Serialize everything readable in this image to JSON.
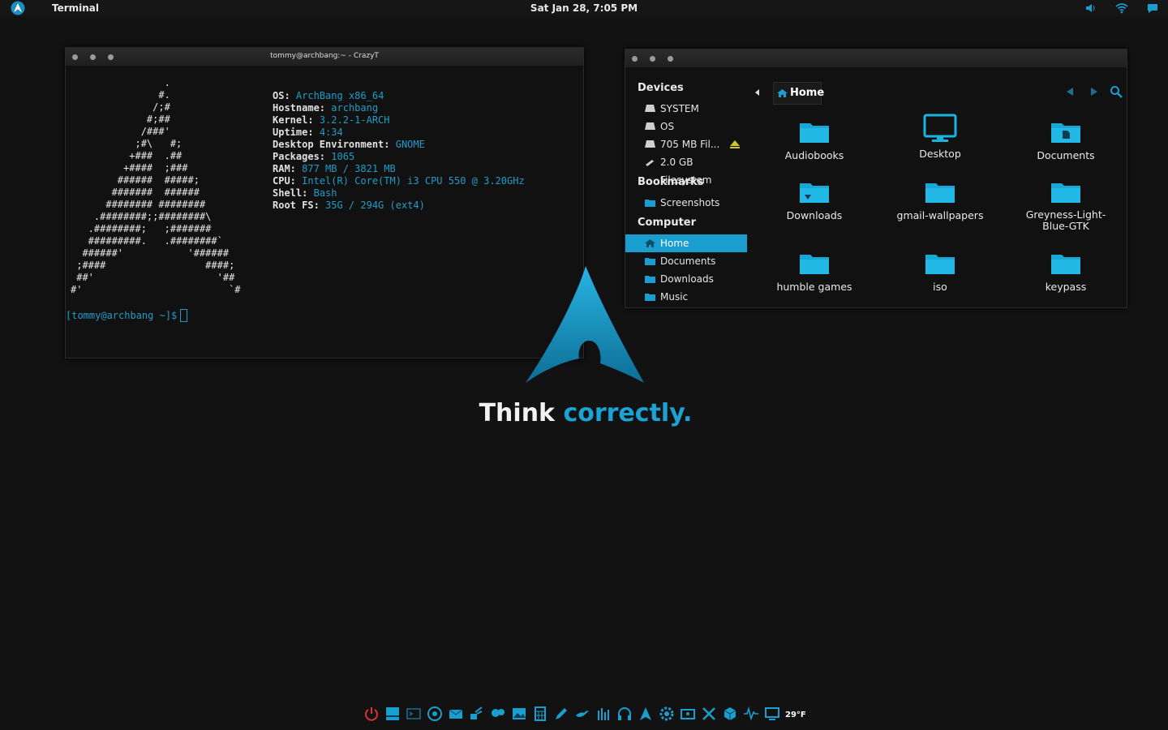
{
  "topbar": {
    "app_name": "Terminal",
    "clock": "Sat Jan 28, 7:05 PM"
  },
  "terminal": {
    "title": "tommy@archbang:~ - CrazyT",
    "ascii_art": "                .\n               #.\n              /;#\n             #;##\n            /###'\n           ;#\\   #;\n          +###  .##\n         +####  ;###\n        ######  #####;\n       #######  ######\n      ######## ########\n    .########;;########\\\n   .########;   ;#######\n   #########.   .########`\n  ######'           '######\n ;####                 ####;\n ##'                     '##\n#'                         `#",
    "info": [
      {
        "key": "OS:",
        "value": "ArchBang x86_64"
      },
      {
        "key": "Hostname:",
        "value": "archbang"
      },
      {
        "key": "Kernel:",
        "value": "3.2.2-1-ARCH"
      },
      {
        "key": "Uptime:",
        "value": "4:34"
      },
      {
        "key": "Desktop Environment:",
        "value": "GNOME"
      },
      {
        "key": "Packages:",
        "value": "1065"
      },
      {
        "key": "RAM:",
        "value": "877 MB / 3821 MB"
      },
      {
        "key": "CPU:",
        "value": "Intel(R) Core(TM) i3 CPU 550 @ 3.20GHz"
      },
      {
        "key": "Shell:",
        "value": "Bash"
      },
      {
        "key": "Root FS:",
        "value": "35G / 294G (ext4)"
      }
    ],
    "prompt": "[tommy@archbang ~]$"
  },
  "filemanager": {
    "sidebar": {
      "devices_heading": "Devices",
      "devices": [
        "SYSTEM",
        "OS",
        "705 MB Fil...",
        "2.0 GB Filesystem"
      ],
      "bookmarks_heading": "Bookmarks",
      "bookmarks": [
        "Screenshots"
      ],
      "computer_heading": "Computer",
      "computer": [
        "Home",
        "Documents",
        "Downloads",
        "Music"
      ]
    },
    "path": "Home",
    "items": [
      "Audiobooks",
      "Desktop",
      "Documents",
      "Downloads",
      "gmail-wallpapers",
      "Greyness-Light-Blue-GTK",
      "humble games",
      "iso",
      "keypass"
    ]
  },
  "desktop": {
    "slogan_part1": "Think ",
    "slogan_part2": "correctly."
  },
  "dock": {
    "temperature": "29°F"
  },
  "colors": {
    "accent": "#1a9ed0",
    "background": "#121212"
  }
}
